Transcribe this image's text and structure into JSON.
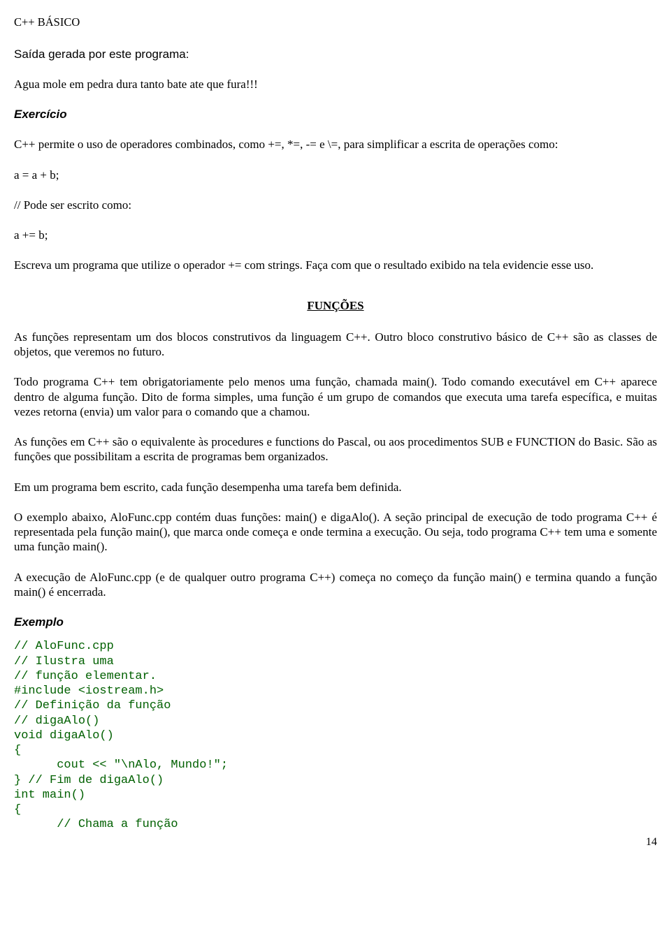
{
  "header": {
    "title": "C++ BÁSICO"
  },
  "output_label": "Saída gerada por este programa:",
  "output_text": "Agua mole em pedra dura tanto bate ate que fura!!!",
  "exercise_label": "Exercício",
  "exercise": {
    "p1": "C++ permite o uso de operadores combinados, como +=, *=, -= e \\=, para simplificar a escrita de operações como:",
    "line1": "a = a + b;",
    "line2": "// Pode ser escrito como:",
    "line3": "a += b;",
    "p2": "Escreva um programa que utilize o operador += com strings. Faça com que o resultado exibido na tela evidencie esse uso."
  },
  "section_heading": "FUNÇÕES",
  "body": {
    "p1": "As funções representam um dos blocos construtivos da linguagem C++. Outro bloco construtivo básico de C++ são as classes de objetos, que veremos no futuro.",
    "p2": "Todo programa C++ tem obrigatoriamente pelo menos uma função, chamada main(). Todo comando executável em C++ aparece dentro de alguma função. Dito de forma simples, uma função é um grupo de comandos que executa uma tarefa específica, e muitas vezes retorna (envia) um valor para o comando que a chamou.",
    "p3": "As funções em C++ são o equivalente às procedures e functions do Pascal, ou aos procedimentos SUB e FUNCTION do Basic. São as funções que possibilitam a escrita de programas bem organizados.",
    "p4": "Em um programa bem escrito, cada função desempenha uma tarefa bem definida.",
    "p5": "O exemplo abaixo, AloFunc.cpp contém duas funções: main() e digaAlo(). A seção principal de execução de todo programa C++ é representada pela função main(), que marca onde começa e onde termina a execução. Ou seja, todo programa C++ tem uma e somente uma função main().",
    "p6": "A execução de AloFunc.cpp (e de qualquer outro programa C++) começa no começo da função main() e termina quando a função main() é encerrada."
  },
  "example_label": "Exemplo",
  "code": "// AloFunc.cpp\n// Ilustra uma\n// função elementar.\n#include <iostream.h>\n// Definição da função\n// digaAlo()\nvoid digaAlo()\n{\n      cout << \"\\nAlo, Mundo!\";\n} // Fim de digaAlo()\nint main()\n{\n      // Chama a função",
  "page_number": "14"
}
